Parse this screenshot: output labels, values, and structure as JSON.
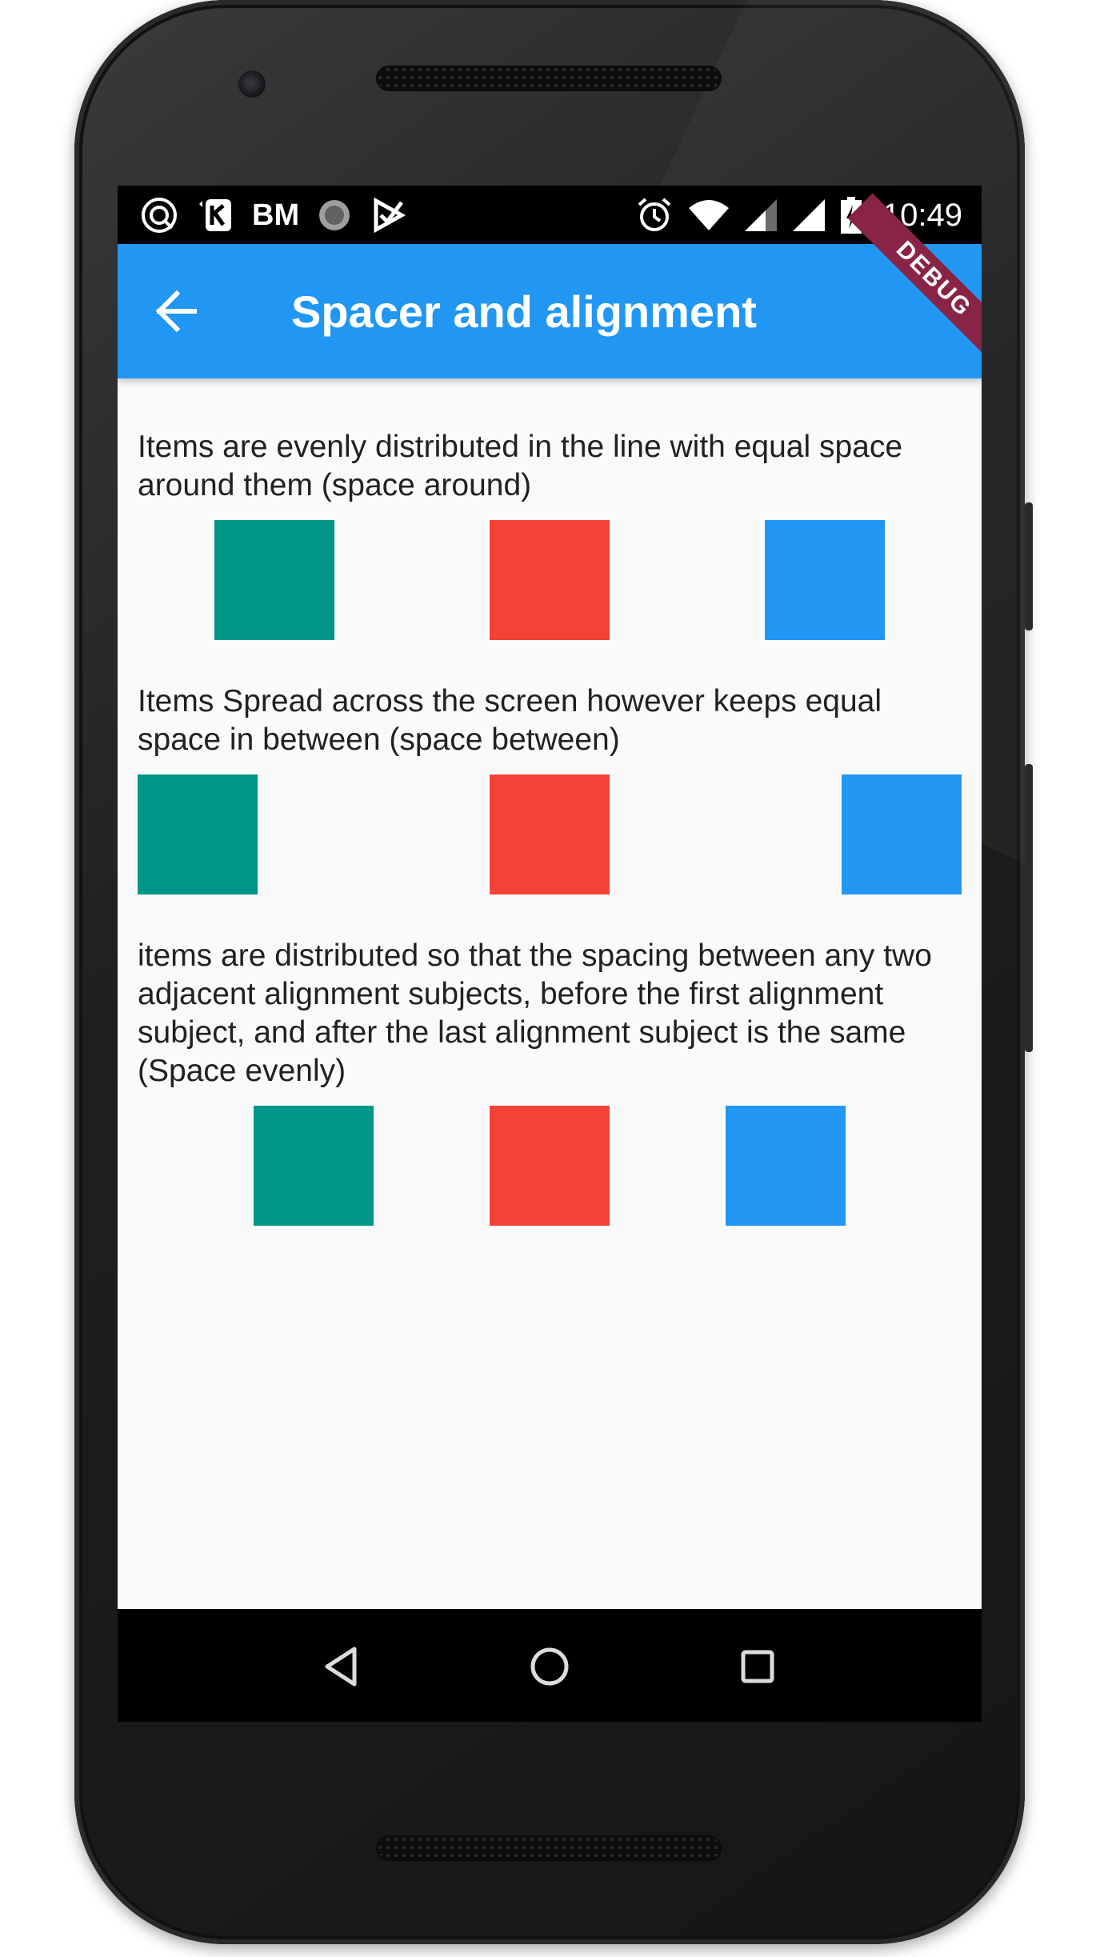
{
  "status_bar": {
    "carrier_text": "BM",
    "time": "10:49",
    "icons_left": [
      "app-notification-icon",
      "k-notification-icon",
      "loading-icon",
      "check-notification-icon"
    ],
    "icons_right": [
      "alarm-icon",
      "wifi-icon",
      "signal-icon",
      "signal-full-icon",
      "battery-charging-icon"
    ]
  },
  "app_bar": {
    "title": "Spacer and alignment",
    "back_icon": "arrow-back-icon",
    "color": "#2196F3",
    "debug_banner": "DEBUG"
  },
  "sections": [
    {
      "description": "Items are evenly distributed in the line with equal space around them (space around)",
      "colors": [
        "#009688",
        "#F44336",
        "#2196F3"
      ]
    },
    {
      "description": "Items Spread across the screen however keeps equal space in  between (space between)",
      "colors": [
        "#009688",
        "#F44336",
        "#2196F3"
      ]
    },
    {
      "description": "items are distributed so that the spacing between any two adjacent alignment subjects, before the first alignment subject, and after the last alignment subject is the same (Space evenly)",
      "colors": [
        "#009688",
        "#F44336",
        "#2196F3"
      ]
    }
  ],
  "nav_bar": {
    "buttons": [
      "back-triangle-icon",
      "home-circle-icon",
      "recents-square-icon"
    ]
  }
}
